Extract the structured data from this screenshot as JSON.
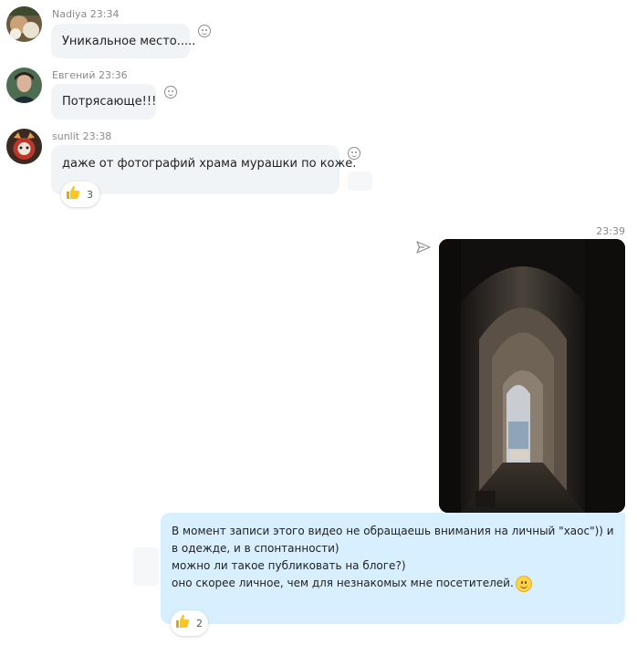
{
  "colors": {
    "incoming_bubble": "#f1f4f7",
    "outgoing_bubble": "#d7efff",
    "meta_text": "#8a8a8a"
  },
  "messages": [
    {
      "author": "Nadiya",
      "time": "23:34",
      "text": "Уникальное место.....",
      "reaction_icon": "smile-icon"
    },
    {
      "author": "Евгений",
      "time": "23:36",
      "text": "Потрясающе!!!",
      "reaction_icon": "smile-icon"
    },
    {
      "author": "sunlit",
      "time": "23:38",
      "text": "даже от фотографий храма мурашки по коже.",
      "reaction_icon": "smile-icon",
      "reaction": {
        "icon": "thumbs-up-icon",
        "count": "3"
      }
    }
  ],
  "outgoing": {
    "time": "23:39",
    "status_icon": "send-icon",
    "photo_icon": "arched-corridor-photo",
    "lines": [
      "В момент записи этого видео не обращаешь внимания на личный \"хаос\")) и",
      "в одежде, и в спонтанности)",
      "можно ли такое публиковать на блоге?)",
      "оно скорее личное, чем для незнакомых мне посетителей."
    ],
    "emoji_icon": "smiley-emoji-icon",
    "reaction": {
      "icon": "thumbs-up-icon",
      "count": "2"
    }
  }
}
